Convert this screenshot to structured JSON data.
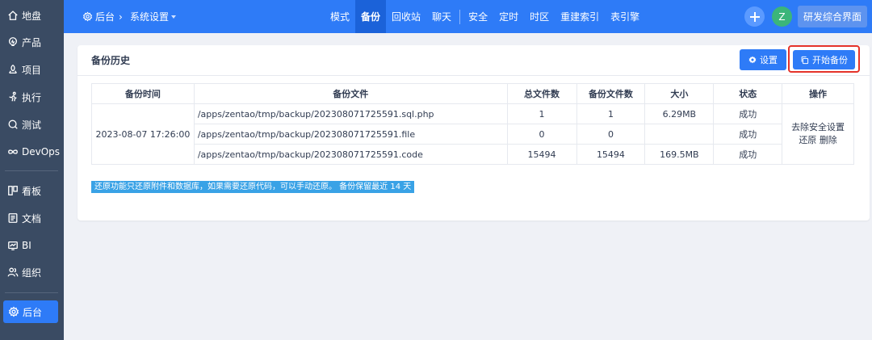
{
  "sidebar": {
    "items": [
      {
        "label": "地盘",
        "icon": "home-icon"
      },
      {
        "label": "产品",
        "icon": "lightbulb-icon"
      },
      {
        "label": "项目",
        "icon": "project-icon"
      },
      {
        "label": "执行",
        "icon": "run-icon"
      },
      {
        "label": "测试",
        "icon": "search-icon"
      },
      {
        "label": "DevOps",
        "icon": "infinity-icon"
      },
      {
        "label": "看板",
        "icon": "kanban-icon"
      },
      {
        "label": "文档",
        "icon": "document-icon"
      },
      {
        "label": "BI",
        "icon": "monitor-icon"
      },
      {
        "label": "组织",
        "icon": "people-icon"
      },
      {
        "label": "后台",
        "icon": "gear-icon",
        "active": true
      }
    ]
  },
  "header": {
    "crumb_home": "后台",
    "crumb_current": "系统设置",
    "tabs": [
      "模式",
      "备份",
      "回收站",
      "聊天",
      "安全",
      "定时",
      "时区",
      "重建索引",
      "表引擎"
    ],
    "active_tab": "备份",
    "avatar": "Z",
    "vision_label": "研发综合界面"
  },
  "panel": {
    "title": "备份历史",
    "settings_label": "设置",
    "start_backup_label": "开始备份"
  },
  "table": {
    "headers": [
      "备份时间",
      "备份文件",
      "总文件数",
      "备份文件数",
      "大小",
      "状态",
      "操作"
    ],
    "time": "2023-08-07 17:26:00",
    "rows": [
      {
        "file": "/apps/zentao/tmp/backup/202308071725591.sql.php",
        "total": "1",
        "backed": "1",
        "size": "6.29MB",
        "status": "成功"
      },
      {
        "file": "/apps/zentao/tmp/backup/202308071725591.file",
        "total": "0",
        "backed": "0",
        "size": "",
        "status": "成功"
      },
      {
        "file": "/apps/zentao/tmp/backup/202308071725591.code",
        "total": "15494",
        "backed": "15494",
        "size": "169.5MB",
        "status": "成功"
      }
    ],
    "ops": {
      "remove_safe": "去除安全设置",
      "restore": "还原",
      "delete": "删除"
    }
  },
  "note": "还原功能只还原附件和数据库，如果需要还原代码，可以手动还原。 备份保留最近 14 天",
  "colors": {
    "primary": "#2e7bf7",
    "sidebar": "#3a4b63",
    "highlight": "#e5332a",
    "note": "#39a2e6"
  }
}
